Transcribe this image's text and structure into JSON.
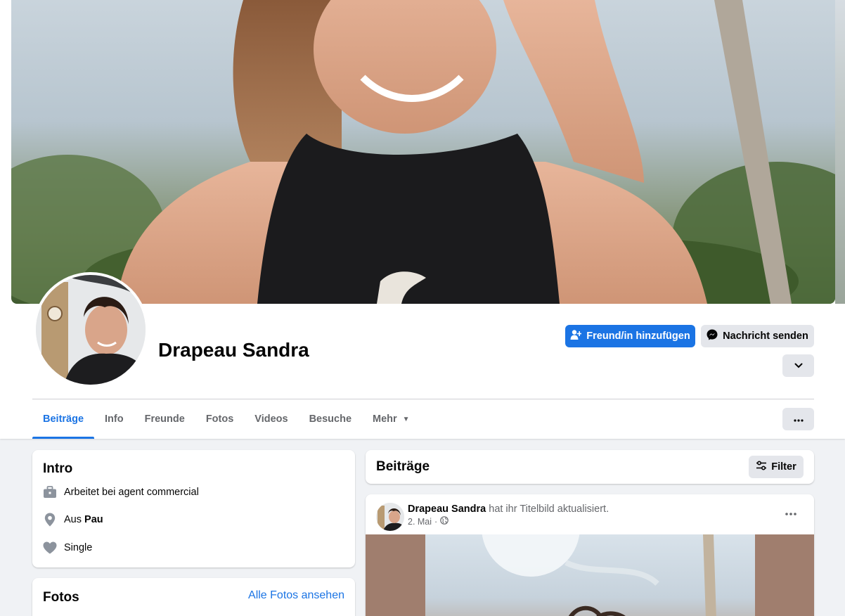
{
  "profile": {
    "name": "Drapeau Sandra"
  },
  "actions": {
    "add_friend": "Freund/in hinzufügen",
    "send_message": "Nachricht senden"
  },
  "tabs": [
    {
      "label": "Beiträge",
      "active": true
    },
    {
      "label": "Info"
    },
    {
      "label": "Freunde"
    },
    {
      "label": "Fotos"
    },
    {
      "label": "Videos"
    },
    {
      "label": "Besuche"
    },
    {
      "label": "Mehr"
    }
  ],
  "intro": {
    "title": "Intro",
    "work": "Arbeitet bei agent commercial",
    "from_prefix": "Aus",
    "from_place": "Pau",
    "relationship": "Single"
  },
  "photos": {
    "title": "Fotos",
    "see_all": "Alle Fotos ansehen"
  },
  "posts": {
    "title": "Beiträge",
    "filter_label": "Filter",
    "items": [
      {
        "author": "Drapeau Sandra",
        "action": "hat ihr Titelbild aktualisiert.",
        "date": "2. Mai",
        "separator": "·",
        "audience_icon": "globe-icon"
      }
    ]
  },
  "colors": {
    "accent": "#1b74e4",
    "secondary_button": "#e4e6eb",
    "page_bg": "#f0f2f5",
    "muted_text": "#65676b"
  }
}
